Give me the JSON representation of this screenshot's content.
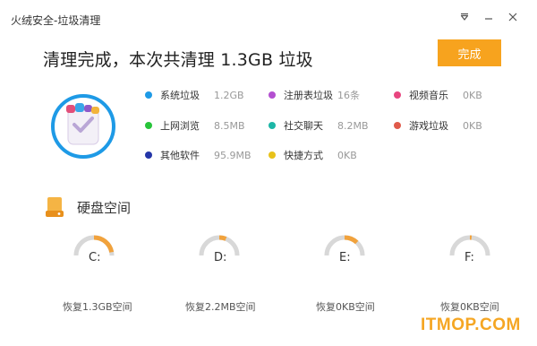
{
  "window": {
    "title": "火绒安全-垃圾清理"
  },
  "result": {
    "headline": "清理完成，本次共清理 1.3GB 垃圾",
    "done_label": "完成"
  },
  "categories": [
    {
      "name": "系统垃圾",
      "size": "1.2GB",
      "color": "#1e9ae6"
    },
    {
      "name": "注册表垃圾",
      "size": "16条",
      "color": "#b34fd0"
    },
    {
      "name": "视频音乐",
      "size": "0KB",
      "color": "#e8457f"
    },
    {
      "name": "上网浏览",
      "size": "8.5MB",
      "color": "#27c43a"
    },
    {
      "name": "社交聊天",
      "size": "8.2MB",
      "color": "#1cb6a6"
    },
    {
      "name": "游戏垃圾",
      "size": "0KB",
      "color": "#e05a4a"
    },
    {
      "name": "其他软件",
      "size": "95.9MB",
      "color": "#2436a8"
    },
    {
      "name": "快捷方式",
      "size": "0KB",
      "color": "#e8c21a"
    }
  ],
  "disk": {
    "title": "硬盘空间",
    "drives": [
      {
        "letter": "C:",
        "free": "恢复1.3GB空间",
        "fraction": 0.22
      },
      {
        "letter": "D:",
        "free": "恢复2.2MB空间",
        "fraction": 0.06
      },
      {
        "letter": "E:",
        "free": "恢复0KB空间",
        "fraction": 0.12
      },
      {
        "letter": "F:",
        "free": "恢复0KB空间",
        "fraction": 0.015
      }
    ]
  },
  "watermark": {
    "text": "ITMOP.COM"
  },
  "colors": {
    "accent": "#f7a31e",
    "ring_fill": "#f1a23c",
    "ring_track": "#d8d8d8",
    "icon_ring": "#1e9ae6",
    "watermark": "#f5a623"
  }
}
